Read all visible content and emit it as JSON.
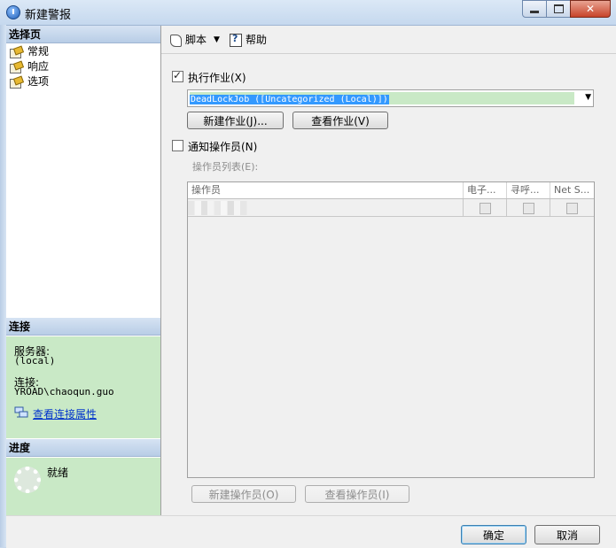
{
  "window": {
    "title": "新建警报"
  },
  "left_panel": {
    "select_page_header": "选择页",
    "pages": [
      {
        "label": "常规"
      },
      {
        "label": "响应"
      },
      {
        "label": "选项"
      }
    ],
    "connection_header": "连接",
    "server_label": "服务器:",
    "server_value": "(local)",
    "connection_label": "连接:",
    "connection_value": "YROAD\\chaoqun.guo",
    "view_connection_link": "查看连接属性",
    "progress_header": "进度",
    "progress_status": "就绪"
  },
  "toolbar": {
    "script_label": "脚本",
    "help_label": "帮助"
  },
  "response": {
    "execute_job_label": "执行作业(X)",
    "execute_job_checked": true,
    "job_selected": "DeadLockJob ([Uncategorized (Local)])",
    "new_job_button": "新建作业(J)...",
    "view_job_button": "查看作业(V)",
    "notify_operators_label": "通知操作员(N)",
    "notify_operators_checked": false,
    "operator_list_label": "操作员列表(E):",
    "grid_columns": [
      "操作员",
      "电子...",
      "寻呼...",
      "Net S..."
    ],
    "new_operator_button": "新建操作员(O)",
    "view_operator_button": "查看操作员(I)"
  },
  "footer": {
    "ok_button": "确定",
    "cancel_button": "取消"
  }
}
